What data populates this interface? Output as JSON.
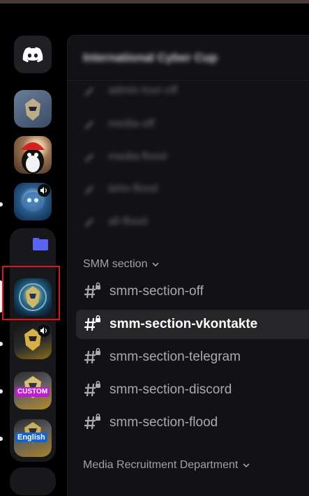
{
  "server_rail": {
    "items": [
      {
        "name": "Discord Home"
      },
      {
        "name": "Server 1"
      },
      {
        "name": "Server 2"
      },
      {
        "name": "Server 3"
      },
      {
        "name": "Server folder"
      },
      {
        "name": "Selected server"
      },
      {
        "name": "Folder server 2"
      },
      {
        "name": "Folder server 3",
        "badge": "CUSTOM"
      },
      {
        "name": "Folder server 4",
        "badge": "English"
      }
    ]
  },
  "guild": {
    "name": "International Cyber Cup"
  },
  "blurred_channels": [
    {
      "label": "admin-tour-off"
    },
    {
      "label": "media-off"
    },
    {
      "label": "media-flood"
    },
    {
      "label": "tehn-flood"
    },
    {
      "label": "all-flood"
    }
  ],
  "categories": [
    {
      "label": "SMM section"
    },
    {
      "label": "Media Recruitment Department"
    }
  ],
  "channels": [
    {
      "label": "smm-section-off"
    },
    {
      "label": "smm-section-vkontakte"
    },
    {
      "label": "smm-section-telegram"
    },
    {
      "label": "smm-section-discord"
    },
    {
      "label": "smm-section-flood"
    }
  ],
  "colors": {
    "accent_folder": "#5865f2",
    "highlight_box": "#e1141b",
    "active_channel_bg": "#262629"
  }
}
